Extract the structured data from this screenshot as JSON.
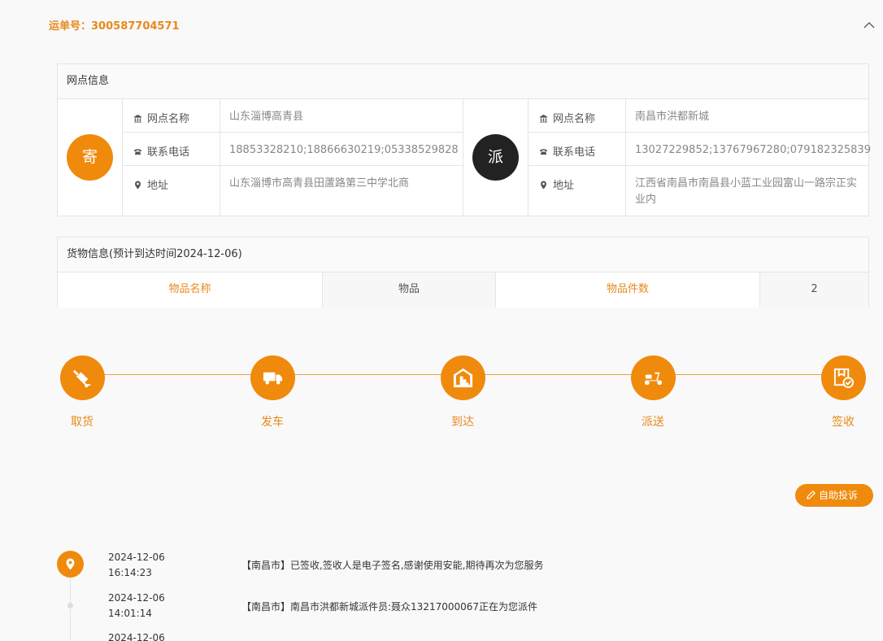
{
  "header": {
    "waybill_label": "运单号：",
    "waybill_number": "300587704571"
  },
  "outlet": {
    "title": "网点信息",
    "sender": {
      "badge": "寄",
      "name_label": "网点名称",
      "name": "山东淄博高青县",
      "phone_label": "联系电话",
      "phone": "18853328210;18866630219;05338529828",
      "address_label": "地址",
      "address": "山东淄博市高青县田蘆路第三中学北商"
    },
    "receiver": {
      "badge": "派",
      "name_label": "网点名称",
      "name": "南昌市洪都新城",
      "phone_label": "联系电话",
      "phone": "13027229852;13767967280;079182325839",
      "address_label": "地址",
      "address": "江西省南昌市南昌县小蓝工业园富山一路宗正实业内"
    }
  },
  "goods": {
    "title": "货物信息(预计到达时间2024-12-06)",
    "item_name_label": "物品名称",
    "item_name": "物品",
    "item_count_label": "物品件数",
    "item_count": "2"
  },
  "progress": {
    "accent": "#f08a0c",
    "steps": [
      {
        "label": "取货",
        "icon": "hand-truck-icon"
      },
      {
        "label": "发车",
        "icon": "truck-icon"
      },
      {
        "label": "到达",
        "icon": "warehouse-icon"
      },
      {
        "label": "派送",
        "icon": "scooter-icon"
      },
      {
        "label": "签收",
        "icon": "signed-package-icon"
      }
    ]
  },
  "complain_button": "自助投诉",
  "timeline": [
    {
      "date": "2024-12-06",
      "time": "16:14:23",
      "text": "【南昌市】已签收,签收人是电子签名,感谢使用安能,期待再次为您服务"
    },
    {
      "date": "2024-12-06",
      "time": "14:01:14",
      "text": "【南昌市】南昌市洪都新城派件员:聂众13217000067正在为您派件"
    },
    {
      "date": "2024-12-06",
      "time": "",
      "text": ""
    }
  ]
}
